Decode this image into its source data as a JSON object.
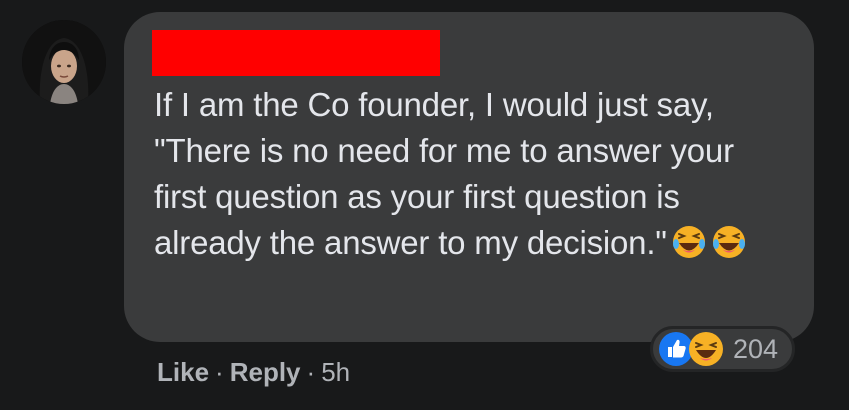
{
  "comment": {
    "author": {
      "avatar_icon": "profile-photo",
      "name_redacted_color": "#ff0000"
    },
    "text": "If I am the Co founder, I would just say, \"There is no need for me to answer your first question as your first question is already the answer to my decision.\"",
    "inline_emojis": [
      "laughing-with-tears-icon",
      "laughing-with-tears-icon"
    ],
    "reactions": {
      "icons": [
        "like-icon",
        "haha-icon"
      ],
      "count": "204"
    },
    "actions": {
      "like_label": "Like",
      "separator": "·",
      "reply_label": "Reply",
      "timestamp": "5h"
    }
  },
  "colors": {
    "background": "#18191a",
    "bubble": "#3a3b3c",
    "text": "#e4e6eb",
    "secondary_text": "#b0b3b8",
    "like_blue": "#1877f2",
    "emoji_yellow": "#f7b125"
  }
}
